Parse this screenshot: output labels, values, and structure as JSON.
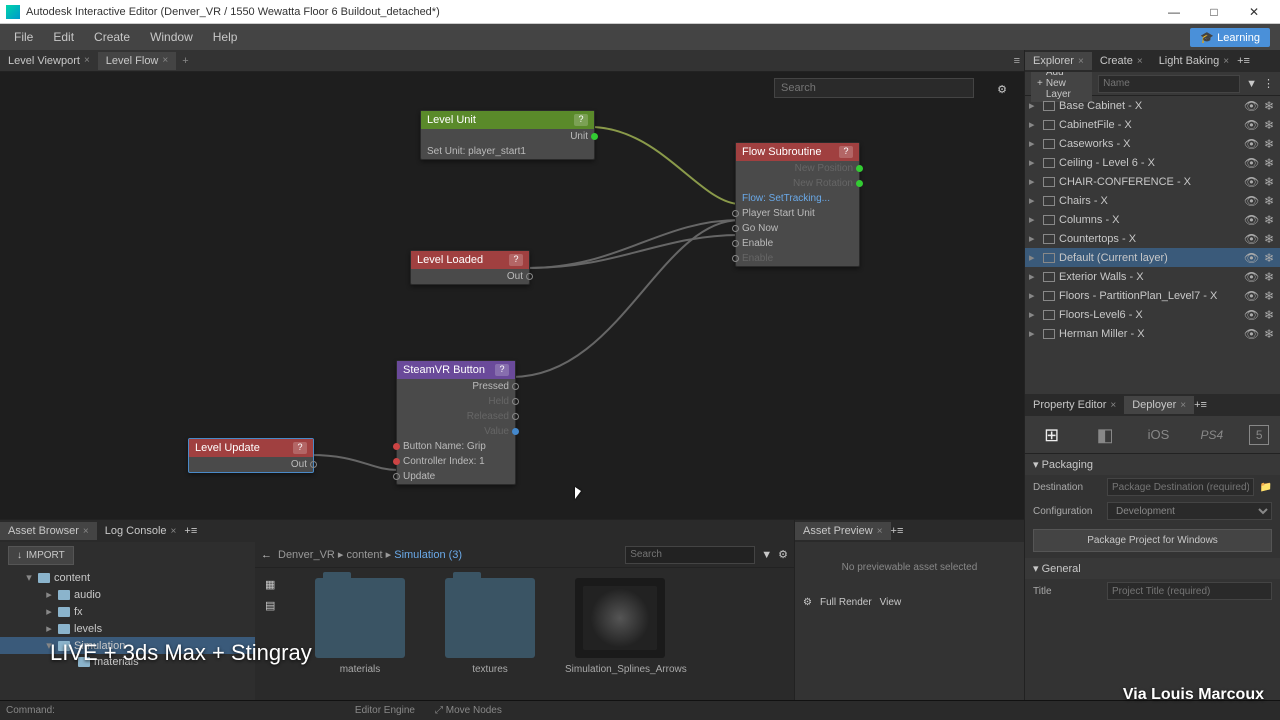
{
  "window_title": "Autodesk Interactive Editor (Denver_VR / 1550 Wewatta Floor 6 Buildout_detached*)",
  "menubar": {
    "file": "File",
    "edit": "Edit",
    "create": "Create",
    "window": "Window",
    "help": "Help",
    "learning": "Learning"
  },
  "left_tabs": {
    "viewport": "Level Viewport",
    "flow": "Level Flow"
  },
  "flow_search_placeholder": "Search",
  "nodes": {
    "level_unit": {
      "title": "Level Unit",
      "unit": "Unit",
      "set_unit": "Set Unit: player_start1"
    },
    "flow_sub": {
      "title": "Flow Subroutine",
      "new_pos": "New Position",
      "new_rot": "New Rotation",
      "flow": "Flow: SetTracking...",
      "player": "Player Start Unit",
      "go": "Go Now",
      "enable": "Enable",
      "enable2": "Enable"
    },
    "level_loaded": {
      "title": "Level Loaded",
      "out": "Out"
    },
    "steamvr": {
      "title": "SteamVR Button",
      "pressed": "Pressed",
      "held": "Held",
      "released": "Released",
      "value": "Value",
      "btn": "Button Name: Grip",
      "ctrl": "Controller Index: 1",
      "update": "Update"
    },
    "level_update": {
      "title": "Level Update",
      "out": "Out"
    }
  },
  "bottom_tabs": {
    "asset": "Asset Browser",
    "log": "Log Console",
    "preview": "Asset Preview"
  },
  "import_btn": "IMPORT",
  "tree": {
    "content": "content",
    "audio": "audio",
    "fx": "fx",
    "levels": "levels",
    "simulation": "Simulation",
    "materials": "materials"
  },
  "breadcrumb": {
    "p1": "Denver_VR",
    "p2": "content",
    "p3": "Simulation (3)"
  },
  "ab_search_placeholder": "Search",
  "grid": {
    "materials": "materials",
    "textures": "textures",
    "sim": "Simulation_Splines_Arrows"
  },
  "preview": {
    "no_asset": "No previewable asset selected",
    "gear": "⚙",
    "full_render": "Full Render",
    "view": "View"
  },
  "right_tabs": {
    "explorer": "Explorer",
    "create": "Create",
    "light": "Light Baking"
  },
  "add_layer": "Add New Layer",
  "layer_search_placeholder": "Name",
  "layers": [
    "Base Cabinet - X",
    "CabinetFile - X",
    "Caseworks - X",
    "Ceiling - Level 6 - X",
    "CHAIR-CONFERENCE - X",
    "Chairs - X",
    "Columns - X",
    "Countertops - X",
    "Default (Current layer)",
    "Exterior Walls - X",
    "Floors - PartitionPlan_Level7 - X",
    "Floors-Level6 - X",
    "Herman Miller - X"
  ],
  "layer_selected_index": 8,
  "prop_tabs": {
    "prop": "Property Editor",
    "deployer": "Deployer"
  },
  "platforms": {
    "win": "⊞",
    "android": "◧",
    "ios": "iOS",
    "ps4": "PS4",
    "html5": "5"
  },
  "deployer": {
    "packaging": "Packaging",
    "dest_label": "Destination",
    "dest_placeholder": "Package Destination (required)",
    "config_label": "Configuration",
    "config_value": "Development",
    "pkg_btn": "Package Project for Windows",
    "general": "General",
    "title_label": "Title",
    "title_placeholder": "Project Title (required)"
  },
  "cmd_bar": {
    "command": "Command:",
    "engine": "Editor Engine",
    "move": "Move Nodes"
  },
  "overlay1": "LIVE + 3ds Max + Stingray",
  "overlay2": "Via Louis Marcoux"
}
